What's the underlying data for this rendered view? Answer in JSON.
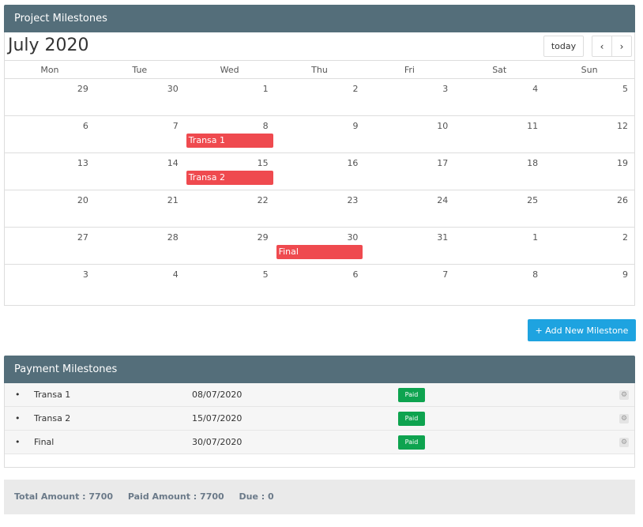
{
  "project": {
    "title": "Project Milestones",
    "month_label": "July 2020",
    "today_label": "today",
    "prev_label": "‹",
    "next_label": "›",
    "weekdays": [
      "Mon",
      "Tue",
      "Wed",
      "Thu",
      "Fri",
      "Sat",
      "Sun"
    ],
    "weeks": [
      [
        "29",
        "30",
        "1",
        "2",
        "3",
        "4",
        "5"
      ],
      [
        "6",
        "7",
        "8",
        "9",
        "10",
        "11",
        "12"
      ],
      [
        "13",
        "14",
        "15",
        "16",
        "17",
        "18",
        "19"
      ],
      [
        "20",
        "21",
        "22",
        "23",
        "24",
        "25",
        "26"
      ],
      [
        "27",
        "28",
        "29",
        "30",
        "31",
        "1",
        "2"
      ],
      [
        "3",
        "4",
        "5",
        "6",
        "7",
        "8",
        "9"
      ]
    ],
    "events": [
      {
        "label": "Transa 1",
        "week": 1,
        "day": 2
      },
      {
        "label": "Transa 2",
        "week": 2,
        "day": 2
      },
      {
        "label": "Final",
        "week": 4,
        "day": 3
      }
    ],
    "event_color": "#ef4a4f"
  },
  "add_button": {
    "label": "+  Add New Milestone",
    "color": "#1ea3e0"
  },
  "payment": {
    "title": "Payment Milestones",
    "rows": [
      {
        "bullet": "•",
        "name": "Transa 1",
        "date": "08/07/2020",
        "status": "Paid"
      },
      {
        "bullet": "•",
        "name": "Transa 2",
        "date": "15/07/2020",
        "status": "Paid"
      },
      {
        "bullet": "•",
        "name": "Final",
        "date": "30/07/2020",
        "status": "Paid"
      }
    ],
    "status_color": "#0ea34f"
  },
  "totals": {
    "total": "Total Amount : 7700",
    "paid": "Paid Amount : 7700",
    "due": "Due : 0"
  }
}
